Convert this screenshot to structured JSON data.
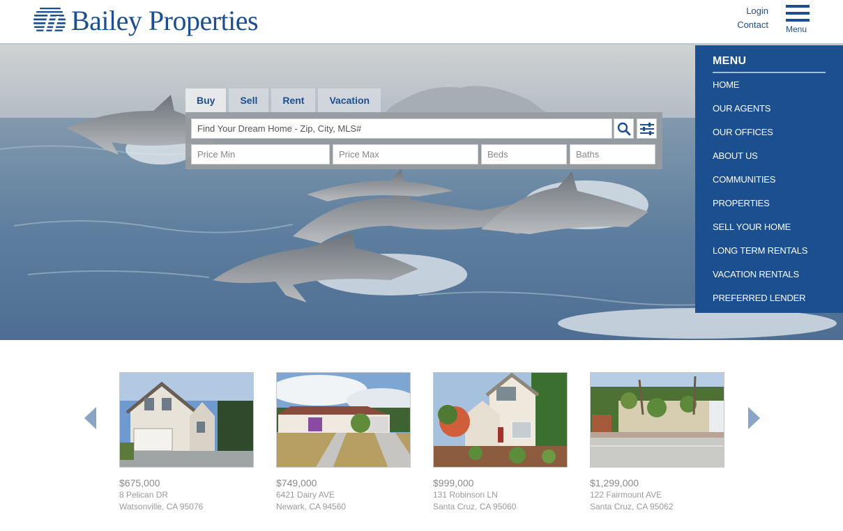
{
  "header": {
    "brand": "Bailey Properties",
    "login": "Login",
    "contact": "Contact",
    "menu_label": "Menu"
  },
  "search": {
    "tabs": [
      "Buy",
      "Sell",
      "Rent",
      "Vacation"
    ],
    "active_tab": "Buy",
    "placeholder": "Find Your Dream Home - Zip, City, MLS#",
    "price_min": "Price Min",
    "price_max": "Price Max",
    "beds": "Beds",
    "baths": "Baths"
  },
  "menu": {
    "title": "MENU",
    "items": [
      "HOME",
      "OUR AGENTS",
      "OUR OFFICES",
      "ABOUT US",
      "COMMUNITIES",
      "PROPERTIES",
      "SELL YOUR HOME",
      "LONG TERM RENTALS",
      "VACATION RENTALS",
      "PREFERRED LENDER"
    ]
  },
  "listings": [
    {
      "price": "$675,000",
      "street": "8 Pelican DR",
      "city": "Watsonville, CA 95076"
    },
    {
      "price": "$749,000",
      "street": "6421 Dairy AVE",
      "city": "Newark, CA 94560"
    },
    {
      "price": "$999,000",
      "street": "131 Robinson LN",
      "city": "Santa Cruz, CA 95060"
    },
    {
      "price": "$1,299,000",
      "street": "122 Fairmount AVE",
      "city": "Santa Cruz, CA 95062"
    }
  ],
  "colors": {
    "brand_blue": "#1c4f8f",
    "menu_bg": "#1c4f8f",
    "arrow": "#8aa4c6",
    "text_gray": "#8a8a8a"
  },
  "icons": [
    "search-icon",
    "filter-sliders-icon",
    "hamburger-icon",
    "chevron-left-icon",
    "chevron-right-icon"
  ]
}
